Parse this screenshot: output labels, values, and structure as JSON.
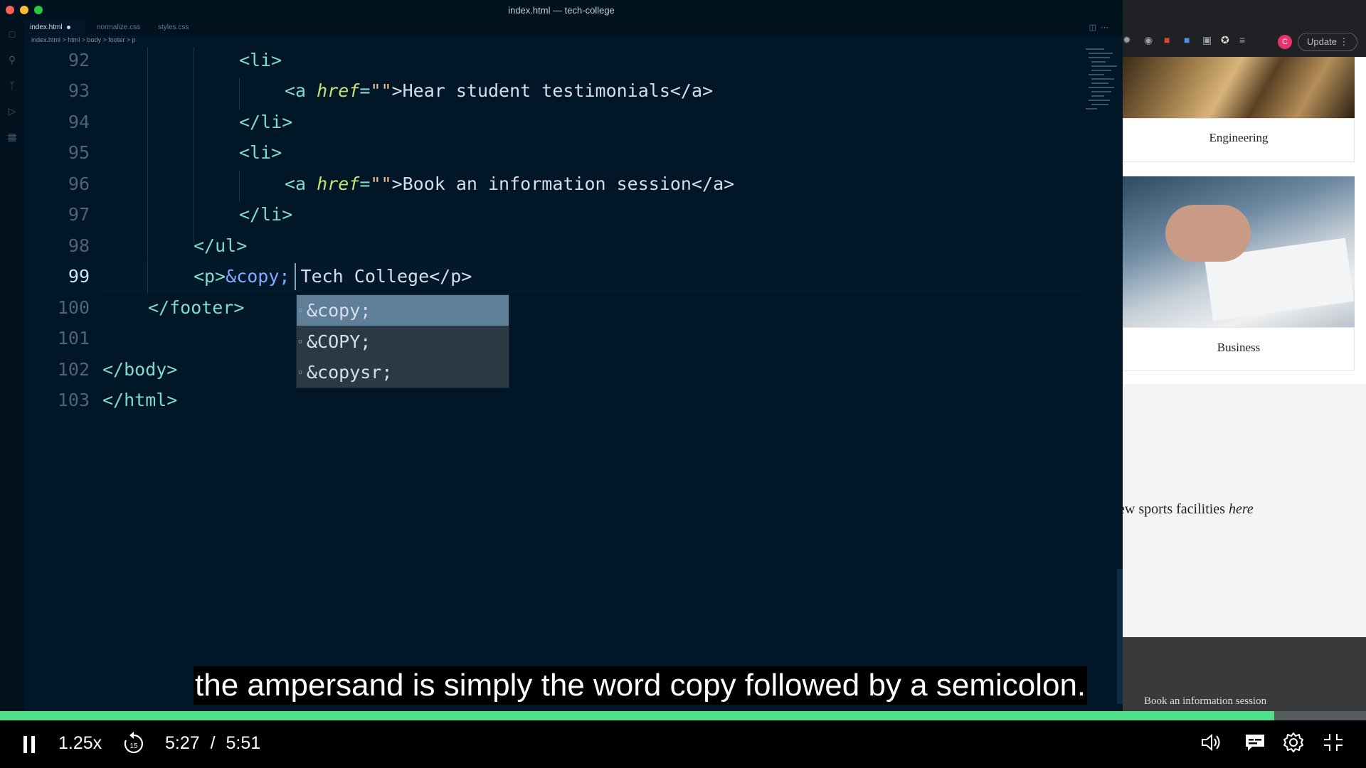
{
  "editor": {
    "window_title": "index.html — tech-college",
    "tabs": [
      {
        "label": "index.html",
        "modified": true
      },
      {
        "label": "normalize.css"
      },
      {
        "label": "styles.css"
      }
    ],
    "breadcrumb": "index.html > html > body > footer > p",
    "current_line": 99,
    "lines": [
      {
        "n": "92"
      },
      {
        "n": "93"
      },
      {
        "n": "94"
      },
      {
        "n": "95"
      },
      {
        "n": "96"
      },
      {
        "n": "97"
      },
      {
        "n": "98"
      },
      {
        "n": "99"
      },
      {
        "n": "100"
      },
      {
        "n": "101"
      },
      {
        "n": "102"
      },
      {
        "n": "103"
      }
    ],
    "code": {
      "l92": "<li>",
      "l93_open": "<a ",
      "l93_attr": "href",
      "l93_eq": "=",
      "l93_str": "\"\"",
      "l93_text": ">Hear student testimonials</a>",
      "l94": "</li>",
      "l95": "<li>",
      "l96_open": "<a ",
      "l96_attr": "href",
      "l96_eq": "=",
      "l96_str": "\"\"",
      "l96_text": ">Book an information session</a>",
      "l97": "</li>",
      "l98": "</ul>",
      "l99_open": "<p>",
      "l99_entity": "&copy;",
      "l99_rest": " Tech College</p>",
      "l100": "</footer>",
      "l102": "</body>",
      "l103": "</html>"
    },
    "suggestions": [
      "&copy;",
      "&COPY;",
      "&copysr;"
    ],
    "selected_suggestion": 0
  },
  "browser": {
    "update_label": "Update",
    "avatar_initial": "C",
    "card1_label": "Engineering",
    "card2_label": "Business",
    "sports_text": "ew sports facilities ",
    "sports_em": "here",
    "footer_text": "Book an information session"
  },
  "player": {
    "caption": "the ampersand is simply the word copy followed by a semicolon.",
    "speed": "1.25x",
    "skip_back": "15",
    "time_current": "5:27",
    "time_sep": "/",
    "time_total": "5:51",
    "progress_fraction": 0.933,
    "progress_color": "#4fe08a"
  }
}
